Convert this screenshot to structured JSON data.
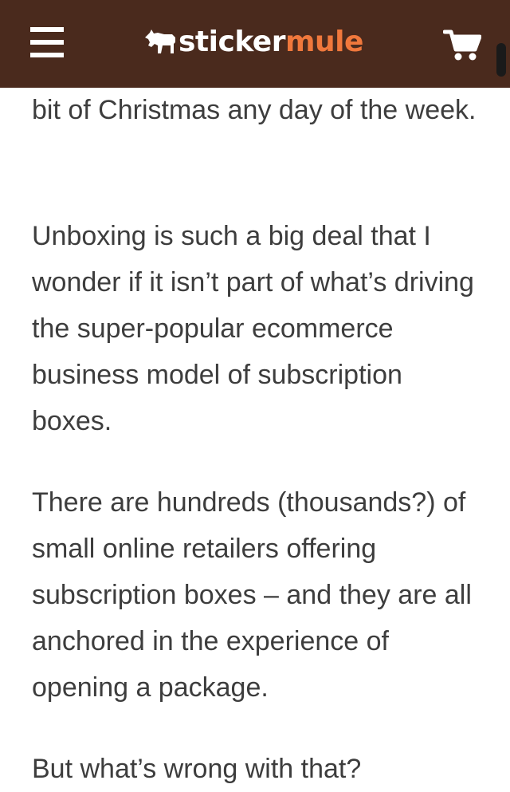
{
  "header": {
    "menu_icon": "hamburger-menu-icon",
    "logo": {
      "part1": "sticker",
      "part2": "mule",
      "mule_color": "#f0783c"
    },
    "cart_icon": "shopping-cart-icon",
    "background": "#4a2a1d"
  },
  "article": {
    "paragraphs": [
      "bit of Christmas any day of the week.",
      "Unboxing is such a big deal that I wonder if it isn’t part of what’s driving the super-popular ecommerce business model of subscription boxes.",
      "There are hundreds (thousands?) of small online retailers offering subscription boxes – and they are all anchored in the experience of opening a package.",
      "But what’s wrong with that?"
    ]
  }
}
